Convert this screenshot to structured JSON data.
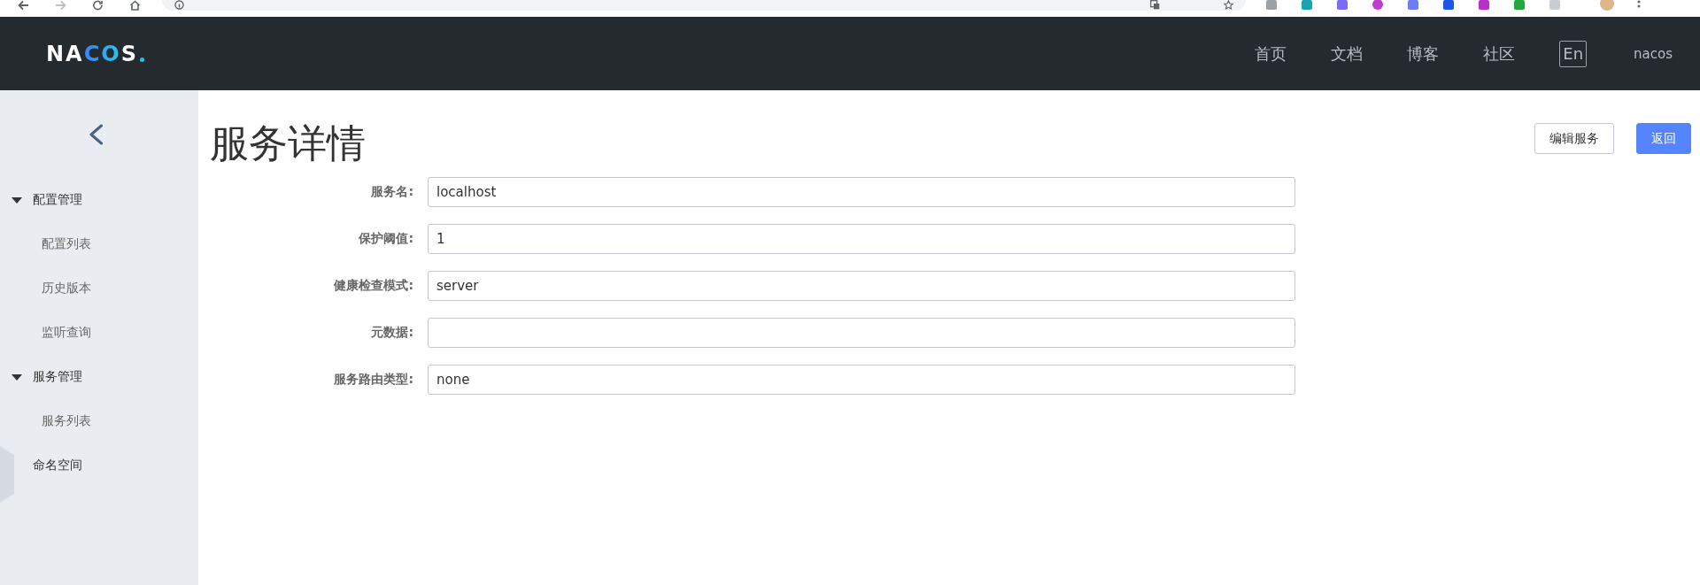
{
  "header": {
    "logo": "NACOS",
    "nav": [
      {
        "label": "首页"
      },
      {
        "label": "文档"
      },
      {
        "label": "博客"
      },
      {
        "label": "社区"
      }
    ],
    "language": "En",
    "user": "nacos"
  },
  "sidebar": {
    "menu": [
      {
        "label": "配置管理",
        "expanded": true,
        "children": [
          {
            "label": "配置列表"
          },
          {
            "label": "历史版本"
          },
          {
            "label": "监听查询"
          }
        ]
      },
      {
        "label": "服务管理",
        "expanded": true,
        "children": [
          {
            "label": "服务列表"
          }
        ]
      },
      {
        "label": "命名空间"
      }
    ]
  },
  "page": {
    "title": "服务详情",
    "actions": [
      {
        "label": "编辑服务",
        "kind": "secondary"
      },
      {
        "label": "返回",
        "kind": "primary"
      }
    ],
    "fields": [
      {
        "label": "服务名:",
        "value": "localhost"
      },
      {
        "label": "保护阈值:",
        "value": "1"
      },
      {
        "label": "健康检查模式:",
        "value": "server"
      },
      {
        "label": "元数据:"
      },
      {
        "label": "服务路由类型:",
        "value": "none"
      }
    ]
  }
}
